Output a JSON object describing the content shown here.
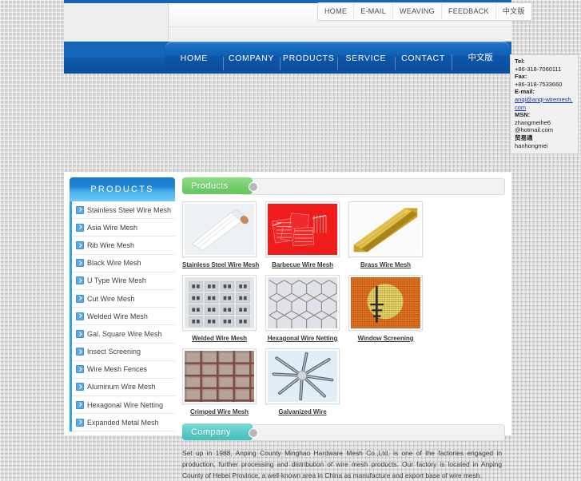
{
  "header": {
    "top_nav": [
      {
        "label": "HOME"
      },
      {
        "label": "E-MAIL"
      },
      {
        "label": "WEAVING"
      },
      {
        "label": "FEEDBACK"
      },
      {
        "label": "中文版"
      }
    ],
    "main_nav": [
      {
        "label": "HOME"
      },
      {
        "label": "COMPANY"
      },
      {
        "label": "PRODUCTS"
      },
      {
        "label": "SERVICE"
      },
      {
        "label": "CONTACT"
      },
      {
        "label": "中文版"
      }
    ]
  },
  "contact": {
    "tel_label": "Tel:",
    "tel_value": "+86-318-7060111",
    "fax_label": "Fax:",
    "fax_value": "+86-318-7533660",
    "email_label": "E-mail:",
    "email_value": "anqi@anqi-wiremesh.com",
    "msn_label": "MSN:",
    "msn_value_1": "zhangmeihe6",
    "msn_value_2": "@hotmail.com",
    "trade_label": "贸易通",
    "trade_value": "hanhongmei"
  },
  "sidebar": {
    "title": "PRODUCTS",
    "items": [
      {
        "label": "Stainless Steel Wire Mesh"
      },
      {
        "label": "Asia Wire Mesh"
      },
      {
        "label": "Rib Wire Mesh"
      },
      {
        "label": "Black Wire Mesh"
      },
      {
        "label": "U Type Wire Mesh"
      },
      {
        "label": "Cut Wire Mesh"
      },
      {
        "label": "Welded Wire Mesh"
      },
      {
        "label": "Gal. Square Wire Mesh"
      },
      {
        "label": "Insect Screening"
      },
      {
        "label": "Wire Mesh Fences"
      },
      {
        "label": "Aluminum Wire Mesh"
      },
      {
        "label": "Hexagonal Wire Netting"
      },
      {
        "label": "Expanded Metal Mesh"
      }
    ]
  },
  "products_section": {
    "title": "Products",
    "items": [
      {
        "caption": "Stainless Steel Wire Mesh",
        "image": "white-mesh-roll"
      },
      {
        "caption": "Barbecue Wire Mesh",
        "image": "red-barbecue-grills"
      },
      {
        "caption": "Brass Wire Mesh",
        "image": "gold-brass-roll"
      },
      {
        "caption": "Welded Wire Mesh",
        "image": "welded-panel-stack"
      },
      {
        "caption": "Hexagonal Wire Netting",
        "image": "hexagonal-netting"
      },
      {
        "caption": "Window Screening",
        "image": "orange-window-screen"
      },
      {
        "caption": "Crimped Wire Mesh",
        "image": "crimped-copper-mesh"
      },
      {
        "caption": "Galvanized Wire",
        "image": "galvanized-wire-coils"
      }
    ]
  },
  "company_section": {
    "title": "Company",
    "text": "Set up in 1988, Anping County Minghao Hardware Mesh Co.,Ltd. is one of the factories engaged in production, further processing and distribution of wire mesh products. Our factory is located in Anping County of Hebei Province, a well-known area in China as manufacture and export base of wire mesh."
  },
  "colors": {
    "nav_blue": "#1565b8",
    "sidebar_blue": "#29a7e8",
    "products_green": "#74cf6d",
    "company_teal": "#58cac6",
    "link_blue": "#1a33cc"
  }
}
